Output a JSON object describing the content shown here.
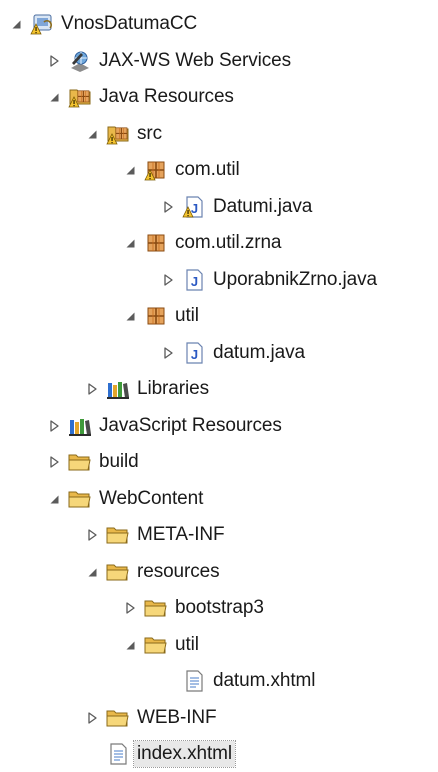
{
  "project_explorer": {
    "rows": [
      {
        "label": "VnosDatumaCC",
        "twisty": "expanded",
        "icon": "project-warning-icon",
        "depth": 0
      },
      {
        "label": "JAX-WS Web Services",
        "twisty": "collapsed",
        "icon": "web-services-icon",
        "depth": 1
      },
      {
        "label": "Java Resources",
        "twisty": "expanded",
        "icon": "java-resources-warning-icon",
        "depth": 1
      },
      {
        "label": "src",
        "twisty": "expanded",
        "icon": "source-folder-warning-icon",
        "depth": 2
      },
      {
        "label": "com.util",
        "twisty": "expanded",
        "icon": "package-warning-icon",
        "depth": 3
      },
      {
        "label": "Datumi.java",
        "twisty": "collapsed",
        "icon": "java-file-warning-icon",
        "depth": 4
      },
      {
        "label": "com.util.zrna",
        "twisty": "expanded",
        "icon": "package-icon",
        "depth": 3
      },
      {
        "label": "UporabnikZrno.java",
        "twisty": "collapsed",
        "icon": "java-file-icon",
        "depth": 4
      },
      {
        "label": "util",
        "twisty": "expanded",
        "icon": "package-icon",
        "depth": 3
      },
      {
        "label": "datum.java",
        "twisty": "collapsed",
        "icon": "java-file-icon",
        "depth": 4
      },
      {
        "label": "Libraries",
        "twisty": "collapsed",
        "icon": "libraries-icon",
        "depth": 2
      },
      {
        "label": "JavaScript Resources",
        "twisty": "collapsed",
        "icon": "libraries-icon",
        "depth": 1
      },
      {
        "label": "build",
        "twisty": "collapsed",
        "icon": "folder-icon",
        "depth": 1
      },
      {
        "label": "WebContent",
        "twisty": "expanded",
        "icon": "folder-icon",
        "depth": 1
      },
      {
        "label": "META-INF",
        "twisty": "collapsed",
        "icon": "folder-icon",
        "depth": 2
      },
      {
        "label": "resources",
        "twisty": "expanded",
        "icon": "folder-icon",
        "depth": 2
      },
      {
        "label": "bootstrap3",
        "twisty": "collapsed",
        "icon": "folder-icon",
        "depth": 3
      },
      {
        "label": "util",
        "twisty": "expanded",
        "icon": "folder-icon",
        "depth": 3
      },
      {
        "label": "datum.xhtml",
        "twisty": "none",
        "icon": "xhtml-file-icon",
        "depth": 4
      },
      {
        "label": "WEB-INF",
        "twisty": "collapsed",
        "icon": "folder-icon",
        "depth": 2
      },
      {
        "label": "index.xhtml",
        "twisty": "none",
        "icon": "xhtml-file-icon",
        "depth": 2,
        "selected": true
      }
    ]
  }
}
